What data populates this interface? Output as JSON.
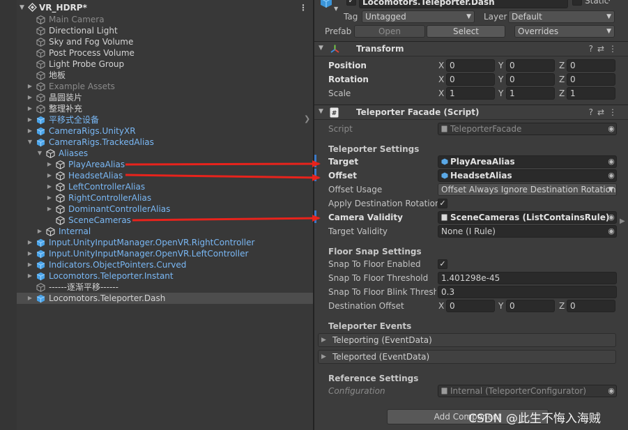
{
  "hierarchy": {
    "scene_name": "VR_HDRP*",
    "rows": [
      {
        "label": "Main Camera",
        "color": "g",
        "indent": 1,
        "fold": "",
        "icon": "cube-gray-icon"
      },
      {
        "label": "Directional Light",
        "color": "w",
        "indent": 1,
        "fold": "",
        "icon": "cube-gray-icon"
      },
      {
        "label": "Sky and Fog Volume",
        "color": "w",
        "indent": 1,
        "fold": "",
        "icon": "cube-gray-icon"
      },
      {
        "label": "Post Process Volume",
        "color": "w",
        "indent": 1,
        "fold": "",
        "icon": "cube-gray-icon"
      },
      {
        "label": "Light Probe Group",
        "color": "w",
        "indent": 1,
        "fold": "",
        "icon": "cube-gray-icon"
      },
      {
        "label": "地板",
        "color": "w",
        "indent": 1,
        "fold": "",
        "icon": "cube-gray-icon"
      },
      {
        "label": "Example Assets",
        "color": "g",
        "indent": 1,
        "fold": "right",
        "icon": "cube-gray-icon"
      },
      {
        "label": "晶圆装片",
        "color": "w",
        "indent": 1,
        "fold": "right",
        "icon": "cube-gray-icon"
      },
      {
        "label": "整理补充",
        "color": "w",
        "indent": 1,
        "fold": "right",
        "icon": "cube-gray-icon"
      },
      {
        "label": "平移式全设备",
        "color": "b",
        "indent": 1,
        "fold": "right",
        "icon": "prefab-cube-icon"
      },
      {
        "label": "CameraRigs.UnityXR",
        "color": "b",
        "indent": 1,
        "fold": "right",
        "icon": "prefab-cube-icon"
      },
      {
        "label": "CameraRigs.TrackedAlias",
        "color": "b",
        "indent": 1,
        "fold": "down",
        "icon": "prefab-cube-icon"
      },
      {
        "label": "Aliases",
        "color": "b",
        "indent": 2,
        "fold": "down",
        "icon": "cube-outline-icon"
      },
      {
        "label": "PlayAreaAlias",
        "color": "b",
        "indent": 3,
        "fold": "right",
        "icon": "cube-outline-icon"
      },
      {
        "label": "HeadsetAlias",
        "color": "b",
        "indent": 3,
        "fold": "right",
        "icon": "cube-outline-icon"
      },
      {
        "label": "LeftControllerAlias",
        "color": "b",
        "indent": 3,
        "fold": "right",
        "icon": "cube-outline-icon"
      },
      {
        "label": "RightControllerAlias",
        "color": "b",
        "indent": 3,
        "fold": "right",
        "icon": "cube-outline-icon"
      },
      {
        "label": "DominantControllerAlias",
        "color": "b",
        "indent": 3,
        "fold": "right",
        "icon": "cube-outline-icon"
      },
      {
        "label": "SceneCameras",
        "color": "b",
        "indent": 3,
        "fold": "",
        "icon": "cube-outline-icon"
      },
      {
        "label": "Internal",
        "color": "b",
        "indent": 2,
        "fold": "right",
        "icon": "cube-outline-icon"
      },
      {
        "label": "Input.UnityInputManager.OpenVR.RightController",
        "color": "b",
        "indent": 1,
        "fold": "right",
        "icon": "prefab-cube-icon"
      },
      {
        "label": "Input.UnityInputManager.OpenVR.LeftController",
        "color": "b",
        "indent": 1,
        "fold": "right",
        "icon": "prefab-cube-icon"
      },
      {
        "label": "Indicators.ObjectPointers.Curved",
        "color": "b",
        "indent": 1,
        "fold": "right",
        "icon": "prefab-cube-icon"
      },
      {
        "label": "Locomotors.Teleporter.Instant",
        "color": "b",
        "indent": 1,
        "fold": "right",
        "icon": "prefab-cube-icon"
      },
      {
        "label": "------逐渐平移------",
        "color": "w",
        "indent": 1,
        "fold": "",
        "icon": "cube-gray-icon"
      },
      {
        "label": "Locomotors.Teleporter.Dash",
        "color": "w",
        "indent": 1,
        "fold": "right",
        "icon": "prefab-cube-icon",
        "selected": true
      }
    ]
  },
  "inspector": {
    "object_name": "Locomotors.Teleporter.Dash",
    "static_label": "Static",
    "tag_label": "Tag",
    "tag_value": "Untagged",
    "layer_label": "Layer",
    "layer_value": "Default",
    "prefab_label": "Prefab",
    "open_label": "Open",
    "select_label": "Select",
    "overrides_label": "Overrides",
    "transform": {
      "title": "Transform",
      "position_label": "Position",
      "rotation_label": "Rotation",
      "scale_label": "Scale",
      "position": {
        "x": "0",
        "y": "0",
        "z": "0"
      },
      "rotation": {
        "x": "0",
        "y": "0",
        "z": "0"
      },
      "scale": {
        "x": "1",
        "y": "1",
        "z": "1"
      }
    },
    "facade": {
      "title": "Teleporter Facade (Script)",
      "script_label": "Script",
      "script_value": "TeleporterFacade",
      "teleporter_settings": "Teleporter Settings",
      "target_label": "Target",
      "target_value": "PlayAreaAlias",
      "offset_label": "Offset",
      "offset_value": "HeadsetAlias",
      "offset_usage_label": "Offset Usage",
      "offset_usage_value": "Offset Always Ignore Destination Rotation",
      "apply_rotation_label": "Apply Destination Rotation",
      "camera_validity_label": "Camera Validity",
      "camera_validity_value": "SceneCameras (ListContainsRule)",
      "target_validity_label": "Target Validity",
      "target_validity_value": "None (I Rule)",
      "floor_snap_settings": "Floor Snap Settings",
      "snap_enabled_label": "Snap To Floor Enabled",
      "snap_threshold_label": "Snap To Floor Threshold",
      "snap_threshold_value": "1.401298e-45",
      "snap_blink_label": "Snap To Floor Blink Thresho",
      "snap_blink_value": "0.3",
      "destination_offset_label": "Destination Offset",
      "destination_offset": {
        "x": "0",
        "y": "0",
        "z": "0"
      },
      "teleporter_events": "Teleporter Events",
      "teleporting_label": "Teleporting (EventData)",
      "teleported_label": "Teleported (EventData)",
      "reference_settings": "Reference Settings",
      "configuration_label": "Configuration",
      "configuration_value": "Internal (TeleporterConfigurator)"
    },
    "add_component_label": "Add Component"
  },
  "axes": {
    "x": "X",
    "y": "Y",
    "z": "Z"
  },
  "watermark": "CSDN @此生不悔入海贼",
  "colors": {
    "arrow": "#e8231c",
    "blue_text": "#7ab8f5",
    "selected_row": "#4d4d4d"
  }
}
